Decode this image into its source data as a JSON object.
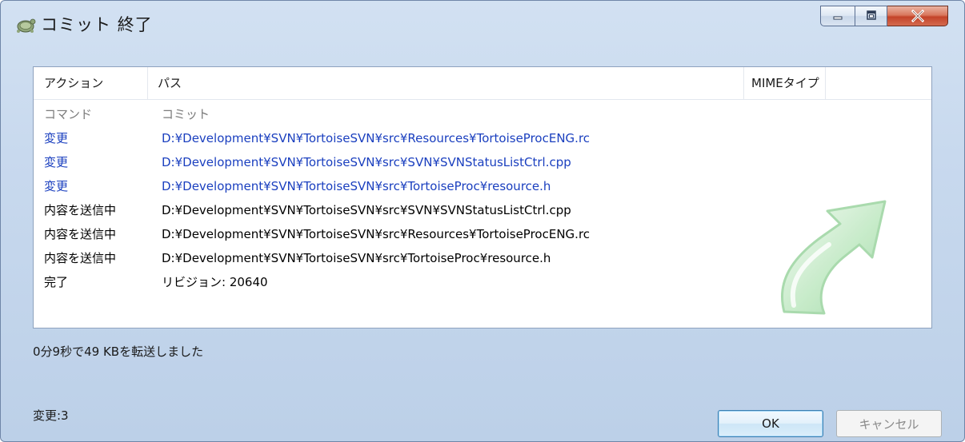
{
  "window": {
    "title": "コミット 終了"
  },
  "list": {
    "columns": [
      "アクション",
      "パス",
      "MIMEタイプ"
    ],
    "rows": [
      {
        "action": "コマンド",
        "path": "コミット",
        "style": "gray"
      },
      {
        "action": "変更",
        "path": "D:¥Development¥SVN¥TortoiseSVN¥src¥Resources¥TortoiseProcENG.rc",
        "style": "blue"
      },
      {
        "action": "変更",
        "path": "D:¥Development¥SVN¥TortoiseSVN¥src¥SVN¥SVNStatusListCtrl.cpp",
        "style": "blue"
      },
      {
        "action": "変更",
        "path": "D:¥Development¥SVN¥TortoiseSVN¥src¥TortoiseProc¥resource.h",
        "style": "blue"
      },
      {
        "action": "内容を送信中",
        "path": "D:¥Development¥SVN¥TortoiseSVN¥src¥SVN¥SVNStatusListCtrl.cpp",
        "style": "black"
      },
      {
        "action": "内容を送信中",
        "path": "D:¥Development¥SVN¥TortoiseSVN¥src¥Resources¥TortoiseProcENG.rc",
        "style": "black"
      },
      {
        "action": "内容を送信中",
        "path": "D:¥Development¥SVN¥TortoiseSVN¥src¥TortoiseProc¥resource.h",
        "style": "black"
      },
      {
        "action": "完了",
        "path": "リビジョン: 20640",
        "style": "black"
      }
    ]
  },
  "status": {
    "transfer": "0分9秒で49 KBを転送しました",
    "changes": "変更:3"
  },
  "buttons": {
    "ok": "OK",
    "cancel": "キャンセル"
  },
  "colors": {
    "gray_text": "#7b7b7b",
    "blue_text": "#1a3fbf",
    "close_button": "#c4442a"
  },
  "icons": [
    "tortoise-icon",
    "minimize-icon",
    "maximize-icon",
    "close-icon",
    "commit-arrow-icon"
  ]
}
